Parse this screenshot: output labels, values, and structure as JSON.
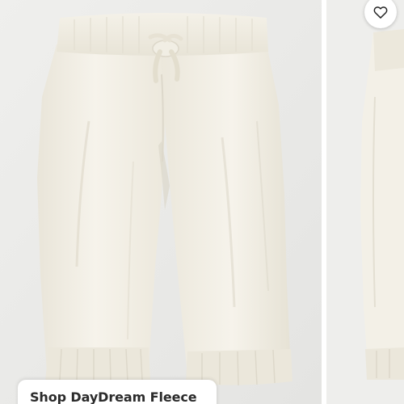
{
  "cta": {
    "label": "Shop DayDream Fleece"
  },
  "wishlist": {
    "icon": "heart-icon"
  },
  "product": {
    "name": "fleece-jogger-pants",
    "color": "#f3f0e7"
  },
  "colors": {
    "background": "#ececea",
    "fabric": "#f3f0e7",
    "text": "#2b2b2b"
  }
}
